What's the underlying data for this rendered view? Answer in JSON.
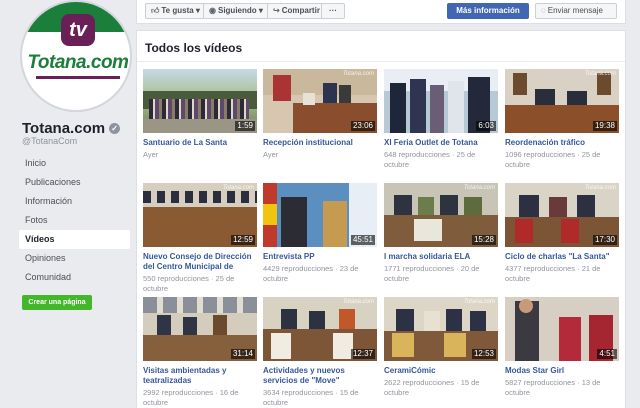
{
  "page": {
    "name": "Totana.com",
    "handle": "@TotanaCom",
    "logo_text": "Totana.com",
    "logo_mark": "tv"
  },
  "nav": [
    {
      "label": "Inicio",
      "active": false
    },
    {
      "label": "Publicaciones",
      "active": false
    },
    {
      "label": "Información",
      "active": false
    },
    {
      "label": "Fotos",
      "active": false
    },
    {
      "label": "Vídeos",
      "active": true
    },
    {
      "label": "Opiniones",
      "active": false
    },
    {
      "label": "Comunidad",
      "active": false
    }
  ],
  "create_page_label": "Crear una página",
  "actions": {
    "like": "Te gusta",
    "follow": "Siguiendo",
    "share": "Compartir",
    "more": "···",
    "more_info": "Más información",
    "message": "Enviar mensaje"
  },
  "section_title": "Todos los vídeos",
  "watermark": "Totana.com",
  "videos": [
    {
      "title": "Santuario de La Santa",
      "meta": "Ayer",
      "duration": "1:59"
    },
    {
      "title": "Recepción institucional",
      "meta": "Ayer",
      "duration": "23:06"
    },
    {
      "title": "XI Feria Outlet de Totana",
      "meta": "648 reproducciones · 25 de octubre",
      "duration": "6:03"
    },
    {
      "title": "Reordenación tráfico",
      "meta": "1096 reproducciones · 25 de octubre",
      "duration": "19:38"
    },
    {
      "title": "Nuevo Consejo de Dirección del Centro Municipal de Personas...",
      "meta": "550 reproducciones · 25 de octubre",
      "duration": "12:59"
    },
    {
      "title": "Entrevista PP",
      "meta": "4429 reproducciones · 23 de octubre",
      "duration": "45:51"
    },
    {
      "title": "I marcha solidaria ELA",
      "meta": "1771 reproducciones · 20 de octubre",
      "duration": "15:28"
    },
    {
      "title": "Ciclo de charlas \"La Santa\"",
      "meta": "4377 reproducciones · 21 de octubre",
      "duration": "17:30"
    },
    {
      "title": "Visitas ambientadas y teatralizadas",
      "meta": "2992 reproducciones · 16 de octubre",
      "duration": "31:14"
    },
    {
      "title": "Actividades y nuevos servicios de \"Move\"",
      "meta": "3634 reproducciones · 15 de octubre",
      "duration": "12:37"
    },
    {
      "title": "CeramiCómic",
      "meta": "2622 reproducciones · 15 de octubre",
      "duration": "12:53"
    },
    {
      "title": "Modas Star Girl",
      "meta": "5827 reproducciones · 13 de octubre",
      "duration": "4:51"
    }
  ]
}
